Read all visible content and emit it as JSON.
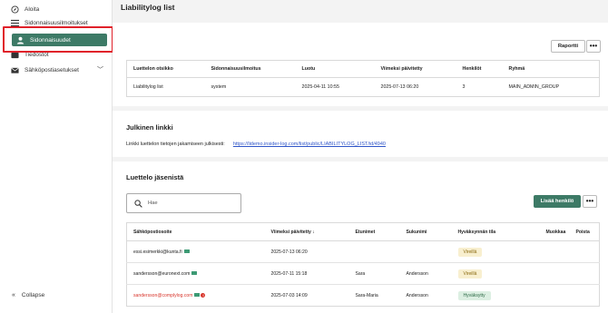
{
  "sidebar": {
    "items": [
      {
        "label": "Aloita",
        "icon": "compass-icon"
      },
      {
        "label": "Sidonnaisuusilmoitukset",
        "icon": "list-icon"
      },
      {
        "label": "Sidonnaisuudet",
        "icon": "user-icon"
      },
      {
        "label": "Tiedostot",
        "icon": "folder-icon"
      },
      {
        "label": "Sähköpostiasetukset",
        "icon": "mail-icon"
      }
    ],
    "collapse_label": "Collapse"
  },
  "page": {
    "title": "Liabilitylog list"
  },
  "summary": {
    "report_label": "Raportti",
    "more_label": "•••",
    "headers": [
      "Luettelon otsikko",
      "Sidonnaisuusilmoitus",
      "Luotu",
      "Viimeksi päivitetty",
      "Henkilöt",
      "Ryhmä"
    ],
    "row": [
      "Liabilitylog list",
      "system",
      "2025-04-11 10:55",
      "2025-07-13 06:20",
      "3",
      "MAIN_ADMIN_GROUP"
    ]
  },
  "public_link": {
    "title": "Julkinen linkki",
    "text": "Linkki luettelon tietojen jakamiseen julkisesti:",
    "url": "https://lidemo.insider-log.com/list/public/LIABILITYLOG_LIST/id/4940"
  },
  "members": {
    "title": "Luettelo jäsenistä",
    "search_placeholder": "Hae",
    "add_label": "Lisää henkilö",
    "more_label": "•••",
    "headers": [
      "Sähköpostiosoite",
      "Viimeksi päivitetty ↓",
      "Etunimet",
      "Sukunimi",
      "Hyväksynnän tila",
      "Muokkaa",
      "Poista"
    ],
    "rows": [
      {
        "email": "essi.esimerkki@kunta.fi",
        "updated": "2025-07-13 06:20",
        "first": "",
        "last": "",
        "status": "Vireillä",
        "status_kind": "wait",
        "email_error": false
      },
      {
        "email": "sandersson@euronext.com",
        "updated": "2025-07-11 15:18",
        "first": "Sara",
        "last": "Andersson",
        "status": "Vireillä",
        "status_kind": "wait",
        "email_error": false
      },
      {
        "email": "sandersson@complylog.com",
        "updated": "2025-07-03 14:09",
        "first": "Sara-Maria",
        "last": "Andersson",
        "status": "Hyväksytty",
        "status_kind": "ok",
        "email_error": true
      }
    ]
  },
  "colors": {
    "accent": "#3d7a66",
    "highlight": "#e0212a",
    "link": "#2f55c8",
    "error": "#d8352b"
  }
}
